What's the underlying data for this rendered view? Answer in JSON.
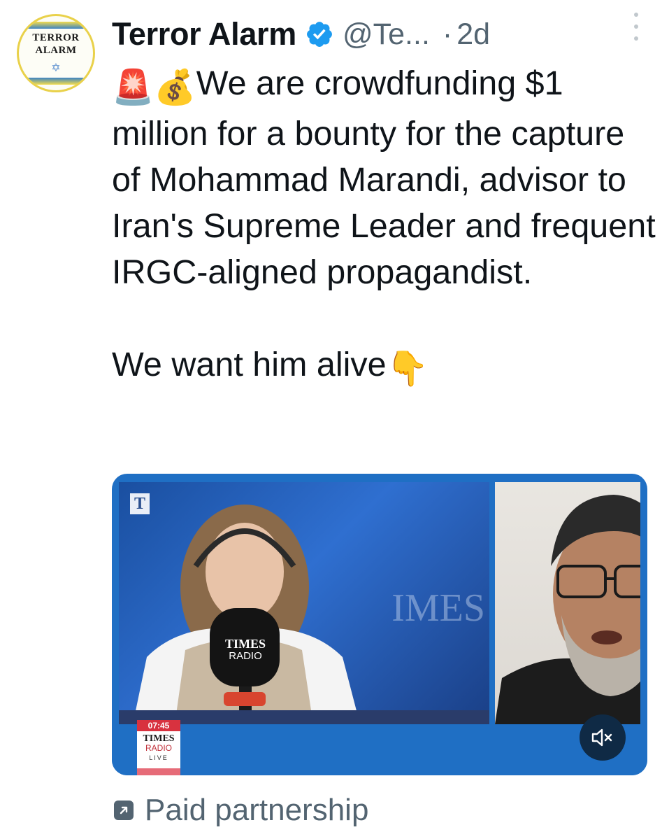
{
  "account": {
    "avatar_text_line1": "TERROR",
    "avatar_text_line2": "ALARM",
    "display_name": "Terror Alarm",
    "handle": "@Te...",
    "separator": "·",
    "time": "2d",
    "verified_color": "#1d9bf0"
  },
  "tweet": {
    "emoji_1": "🚨",
    "emoji_2": "💰",
    "text_main": "We are crowdfunding $1 million for a bounty for the capture of Mohammad Marandi, advisor to Iran's Supreme Leader and frequent IRGC-aligned propagandist.",
    "text_second": "We want him alive",
    "emoji_3": "👇"
  },
  "media": {
    "left_logo": "T",
    "left_bg_word": "IMES",
    "mic_line1": "TIMES",
    "mic_line2": "RADIO",
    "live_time": "07:45",
    "live_times": "TIMES",
    "live_radio": "RADIO",
    "live_label": "LIVE",
    "mute_icon": "speaker-muted-icon",
    "frame_color": "#1f6fc4"
  },
  "footer": {
    "paid_icon": "external-arrow-icon",
    "paid_label": "Paid partnership"
  },
  "colors": {
    "text_primary": "#0f1419",
    "text_secondary": "#536471"
  }
}
